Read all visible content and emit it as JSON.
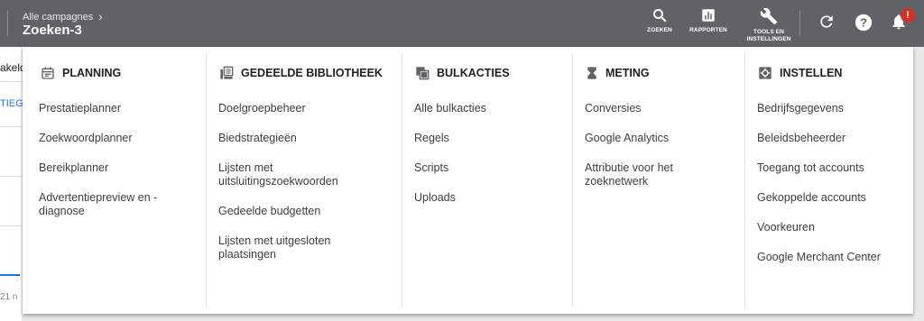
{
  "header": {
    "breadcrumb": "Alle campagnes",
    "title": "Zoeken-3",
    "tools": [
      {
        "label": "ZOEKEN",
        "icon": "search-icon"
      },
      {
        "label": "RAPPORTEN",
        "icon": "reports-icon"
      },
      {
        "label": "TOOLS EN INSTELLINGEN",
        "icon": "wrench-icon"
      }
    ],
    "notification_badge": "!"
  },
  "background": {
    "fragment_top": "akeld",
    "fragment_tab": "TIEG",
    "fragment_date": "21 n"
  },
  "menu": {
    "columns": [
      {
        "title": "PLANNING",
        "icon": "calendar-icon",
        "items": [
          "Prestatieplanner",
          "Zoekwoordplanner",
          "Bereikplanner",
          "Advertentiepreview en -diagnose"
        ]
      },
      {
        "title": "GEDEELDE BIBLIOTHEEK",
        "icon": "library-icon",
        "items": [
          "Doelgroepbeheer",
          "Biedstrategieën",
          "Lijsten met uitsluitingszoekwoorden",
          "Gedeelde budgetten",
          "Lijsten met uitgesloten plaatsingen"
        ]
      },
      {
        "title": "BULKACTIES",
        "icon": "copy-icon",
        "items": [
          "Alle bulkacties",
          "Regels",
          "Scripts",
          "Uploads"
        ]
      },
      {
        "title": "METING",
        "icon": "hourglass-icon",
        "items": [
          "Conversies",
          "Google Analytics",
          "Attributie voor het zoeknetwerk"
        ]
      },
      {
        "title": "INSTELLEN",
        "icon": "settings-box-icon",
        "items": [
          "Bedrijfsgegevens",
          "Beleidsbeheerder",
          "Toegang tot accounts",
          "Gekoppelde accounts",
          "Voorkeuren",
          "Google Merchant Center"
        ]
      }
    ]
  }
}
